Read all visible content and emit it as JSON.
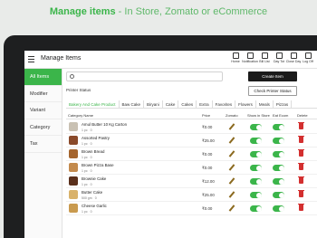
{
  "banner": {
    "highlight": "Manage items",
    "rest": " - In Store, Zomato or eCommerce"
  },
  "colors": {
    "accent": "#3bb54a",
    "delete": "#d32f2f",
    "frame": "#1e1f20"
  },
  "topbar": {
    "title": "Manage Items",
    "actions": [
      {
        "label": "Home",
        "icon": "home-icon"
      },
      {
        "label": "Notification",
        "icon": "bell-icon"
      },
      {
        "label": "Bill List",
        "icon": "bill-list-icon"
      },
      {
        "label": "Day Tot",
        "icon": "chart-icon"
      },
      {
        "label": "Close Day",
        "icon": "close-day-icon"
      },
      {
        "label": "Log Off",
        "icon": "logout-icon"
      }
    ]
  },
  "sidebar": {
    "items": [
      {
        "label": "All Items",
        "active": true
      },
      {
        "label": "Modifier",
        "active": false
      },
      {
        "label": "Variant",
        "active": false
      },
      {
        "label": "Category",
        "active": false
      },
      {
        "label": "Tax",
        "active": false
      }
    ]
  },
  "toolbar": {
    "search_placeholder": "",
    "create_label": "Create Item",
    "printer_status_label": "Printer Status",
    "check_printer_label": "Check Printer Status"
  },
  "tabs": [
    {
      "label": "Bakery And Cake Product",
      "active": true
    },
    {
      "label": "Baw Cake",
      "active": false
    },
    {
      "label": "Biryani",
      "active": false
    },
    {
      "label": "Cake",
      "active": false
    },
    {
      "label": "Cakes",
      "active": false
    },
    {
      "label": "Extra",
      "active": false
    },
    {
      "label": "Favorites",
      "active": false
    },
    {
      "label": "Flowers",
      "active": false
    },
    {
      "label": "Meals",
      "active": false
    },
    {
      "label": "Pizzas",
      "active": false
    }
  ],
  "table": {
    "headers": {
      "category_name": "Category Name",
      "price": "Price",
      "zomato": "Zomato",
      "show_in_store": "Show in Store",
      "ecom": "Eat Ecom",
      "delete": "Delete"
    },
    "rows": [
      {
        "name": "Amul Butter 10 Kg Carton",
        "unit": "1 pc",
        "stock": "0",
        "price": "₹0.00",
        "thumb": "#c9c1b3",
        "show_in_store": true,
        "ecom": true
      },
      {
        "name": "Assorted Pastry",
        "unit": "1 pc",
        "stock": "0",
        "price": "₹25.00",
        "thumb": "#8a4a2a",
        "show_in_store": true,
        "ecom": true
      },
      {
        "name": "Brown Bread",
        "unit": "1 pc",
        "stock": "0",
        "price": "₹0.00",
        "thumb": "#a5652e",
        "show_in_store": true,
        "ecom": true
      },
      {
        "name": "Brown Pizza Base",
        "unit": "1 pc",
        "stock": "0",
        "price": "₹0.00",
        "thumb": "#c38a4d",
        "show_in_store": true,
        "ecom": true
      },
      {
        "name": "Brownie Cake",
        "unit": "1 pc",
        "stock": "0",
        "price": "₹12.00",
        "thumb": "#5a2f1b",
        "show_in_store": true,
        "ecom": true
      },
      {
        "name": "Butter Cake",
        "unit": "500 gm",
        "stock": "0",
        "price": "₹25.00",
        "thumb": "#d9b26a",
        "show_in_store": true,
        "ecom": true
      },
      {
        "name": "Cheese Garlic",
        "unit": "1 pc",
        "stock": "0",
        "price": "₹0.00",
        "thumb": "#c99a4e",
        "show_in_store": true,
        "ecom": true
      }
    ]
  }
}
